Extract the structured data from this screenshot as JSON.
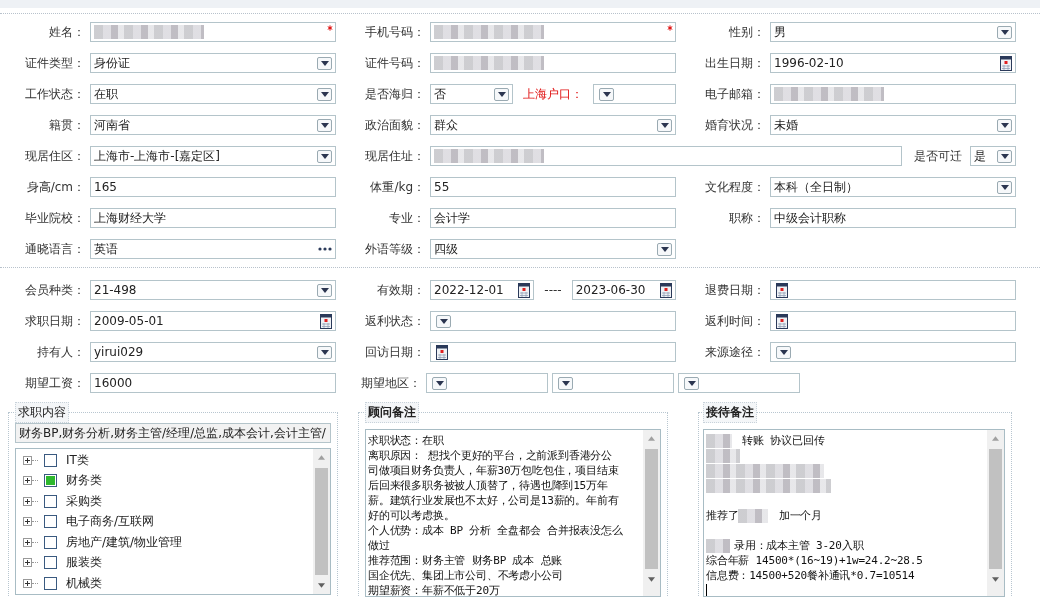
{
  "form_rows": [
    {
      "cells": [
        {
          "label": "姓名：",
          "inputs": [
            {
              "kind": "text",
              "redacted": true,
              "required": true
            }
          ]
        },
        {
          "label": "手机号码：",
          "inputs": [
            {
              "kind": "text",
              "redacted": true,
              "required": true
            }
          ]
        },
        {
          "label": "性别：",
          "inputs": [
            {
              "kind": "select",
              "value": "男"
            }
          ]
        }
      ]
    },
    {
      "cells": [
        {
          "label": "证件类型：",
          "inputs": [
            {
              "kind": "select",
              "value": "身份证"
            }
          ]
        },
        {
          "label": "证件号码：",
          "inputs": [
            {
              "kind": "text",
              "redacted": true
            }
          ]
        },
        {
          "label": "出生日期：",
          "inputs": [
            {
              "kind": "date",
              "value": "1996-02-10"
            }
          ]
        }
      ]
    },
    {
      "cells": [
        {
          "label": "工作状态：",
          "inputs": [
            {
              "kind": "select",
              "value": "在职"
            }
          ]
        },
        {
          "label": "是否海归：",
          "inputs": [
            {
              "kind": "select",
              "value": "否"
            },
            {
              "kind": "label",
              "text": "上海户口：",
              "alert": true
            },
            {
              "kind": "select"
            }
          ]
        },
        {
          "label": "电子邮箱：",
          "inputs": [
            {
              "kind": "text",
              "redacted": true
            }
          ]
        }
      ]
    },
    {
      "cells": [
        {
          "label": "籍贯：",
          "inputs": [
            {
              "kind": "select",
              "value": "河南省"
            }
          ]
        },
        {
          "label": "政治面貌：",
          "inputs": [
            {
              "kind": "select",
              "value": "群众"
            }
          ]
        },
        {
          "label": "婚育状况：",
          "inputs": [
            {
              "kind": "select",
              "value": "未婚"
            }
          ]
        }
      ]
    },
    {
      "cells": [
        {
          "label": "现居住区：",
          "inputs": [
            {
              "kind": "select",
              "value": "上海市-上海市-[嘉定区]"
            }
          ]
        },
        {
          "label": "现居住址：",
          "inputs": [
            {
              "kind": "text",
              "redacted": true
            },
            {
              "kind": "label",
              "text": "是否可迁",
              "alert": false
            },
            {
              "kind": "select",
              "value": "是"
            }
          ]
        }
      ]
    },
    {
      "cells": [
        {
          "label": "身高/cm：",
          "inputs": [
            {
              "kind": "text",
              "value": "165"
            }
          ]
        },
        {
          "label": "体重/kg：",
          "inputs": [
            {
              "kind": "text",
              "value": "55"
            }
          ]
        },
        {
          "label": "文化程度：",
          "inputs": [
            {
              "kind": "select",
              "value": "本科（全日制）"
            }
          ]
        }
      ]
    },
    {
      "cells": [
        {
          "label": "毕业院校：",
          "inputs": [
            {
              "kind": "text",
              "value": "上海财经大学"
            }
          ]
        },
        {
          "label": "专业：",
          "inputs": [
            {
              "kind": "text",
              "value": "会计学"
            }
          ]
        },
        {
          "label": "职称：",
          "inputs": [
            {
              "kind": "text",
              "value": "中级会计职称"
            }
          ]
        }
      ]
    },
    {
      "cells": [
        {
          "label": "通晓语言：",
          "inputs": [
            {
              "kind": "more",
              "value": "英语"
            }
          ]
        },
        {
          "label": "外语等级：",
          "inputs": [
            {
              "kind": "select",
              "value": "四级"
            }
          ]
        }
      ]
    }
  ],
  "member_rows": [
    {
      "cells": [
        {
          "label": "会员种类：",
          "inputs": [
            {
              "kind": "select",
              "value": "21-498"
            }
          ]
        },
        {
          "label": "有效期：",
          "inputs": [
            {
              "kind": "date",
              "value": "2022-12-01"
            },
            {
              "kind": "label",
              "text": "----",
              "alert": false
            },
            {
              "kind": "date",
              "value": "2023-06-30"
            }
          ]
        },
        {
          "label": "退费日期：",
          "inputs": [
            {
              "kind": "date"
            }
          ]
        }
      ]
    },
    {
      "cells": [
        {
          "label": "求职日期：",
          "inputs": [
            {
              "kind": "date",
              "value": "2009-05-01"
            }
          ]
        },
        {
          "label": "返利状态：",
          "inputs": [
            {
              "kind": "select"
            }
          ]
        },
        {
          "label": "返利时间：",
          "inputs": [
            {
              "kind": "date"
            }
          ]
        }
      ]
    },
    {
      "cells": [
        {
          "label": "持有人：",
          "inputs": [
            {
              "kind": "select",
              "value": "yirui029"
            }
          ]
        },
        {
          "label": "回访日期：",
          "inputs": [
            {
              "kind": "date"
            }
          ]
        },
        {
          "label": "来源途径：",
          "inputs": [
            {
              "kind": "select"
            }
          ]
        }
      ]
    },
    {
      "cells": [
        {
          "label": "期望工资：",
          "inputs": [
            {
              "kind": "text",
              "value": "16000"
            }
          ]
        },
        {
          "label": "期望地区：",
          "inputs": [
            {
              "kind": "select"
            },
            {
              "kind": "select"
            },
            {
              "kind": "select"
            }
          ]
        }
      ]
    }
  ],
  "job_content": {
    "legend": "求职内容",
    "summary": "财务BP,财务分析,财务主管/经理/总监,成本会计,会计主管/",
    "tree": [
      {
        "label": "IT类",
        "checked": false,
        "expanded": false
      },
      {
        "label": "财务类",
        "checked": true,
        "expanded": false
      },
      {
        "label": "采购类",
        "checked": false,
        "expanded": false
      },
      {
        "label": "电子商务/互联网",
        "checked": false,
        "expanded": false
      },
      {
        "label": "房地产/建筑/物业管理",
        "checked": false,
        "expanded": false
      },
      {
        "label": "服装类",
        "checked": false,
        "expanded": false
      },
      {
        "label": "机械类",
        "checked": false,
        "expanded": false
      }
    ]
  },
  "advisor_notes": {
    "legend": "顾问备注",
    "lines": [
      "求职状态：在职",
      "离职原因：  想找个更好的平台，之前派到香港分公",
      "司做项目财务负责人，年薪30万包吃包住，项目结束",
      "后回来很多职务被被人顶替了，待遇也降到15万年",
      "薪。建筑行业发展也不太好，公司是13薪的。年前有",
      "好的可以考虑换。",
      "个人优势：成本 BP 分析 全盘都会 合并报表没怎么",
      "做过",
      "推荐范围：财务主管 财务BP 成本 总账",
      "国企优先、集团上市公司、不考虑小公司",
      "期望薪资：年薪不低于20万"
    ]
  },
  "reception_notes": {
    "legend": "接待备注",
    "lines": [
      {
        "kind": "text",
        "segments": [
          {
            "kind": "redacted"
          },
          {
            "kind": "text",
            "text": " 转账 协议已回传"
          }
        ]
      },
      {
        "kind": "text",
        "segments": [
          {
            "kind": "redacted"
          }
        ]
      },
      {
        "kind": "text",
        "segments": [
          {
            "kind": "redacted"
          }
        ]
      },
      {
        "kind": "text",
        "segments": [
          {
            "kind": "redacted"
          }
        ]
      },
      {
        "kind": "blank"
      },
      {
        "kind": "text",
        "segments": [
          {
            "kind": "text",
            "text": "推荐了"
          },
          {
            "kind": "redacted"
          },
          {
            "kind": "text",
            "text": " 加一个月"
          }
        ]
      },
      {
        "kind": "blank"
      },
      {
        "kind": "text",
        "segments": [
          {
            "kind": "redacted"
          },
          {
            "kind": "text",
            "text": "录用：成本主管 3-20入职"
          }
        ]
      },
      {
        "kind": "text",
        "segments": [
          {
            "kind": "text",
            "text": "综合年薪 14500*(16~19)+1w=24.2~28.5"
          }
        ]
      },
      {
        "kind": "text",
        "segments": [
          {
            "kind": "text",
            "text": "信息费：14500+520餐补通讯*0.7=10514"
          }
        ]
      }
    ]
  }
}
